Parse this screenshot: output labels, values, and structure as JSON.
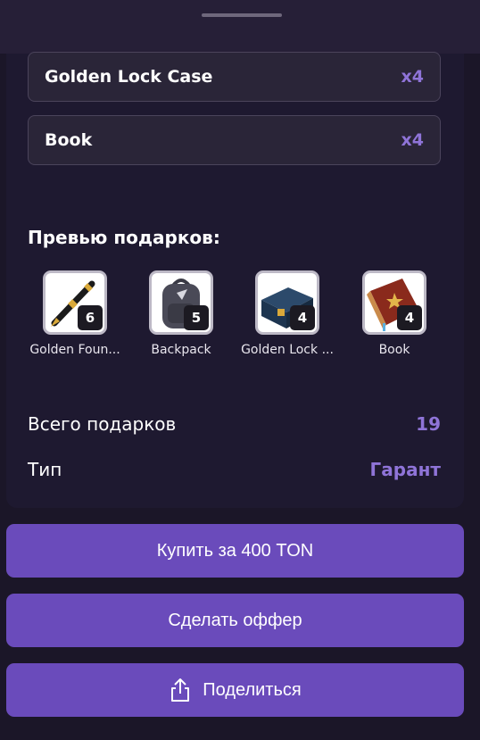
{
  "gifts": [
    {
      "name": "Golden Lock Case",
      "qty": "x4"
    },
    {
      "name": "Book",
      "qty": "x4"
    }
  ],
  "preview": {
    "title": "Превью подарков:",
    "items": [
      {
        "label": "Golden Foun...",
        "count": "6",
        "icon": "fountain-pen-icon"
      },
      {
        "label": "Backpack",
        "count": "5",
        "icon": "backpack-icon"
      },
      {
        "label": "Golden Lock ...",
        "count": "4",
        "icon": "lock-case-icon"
      },
      {
        "label": "Book",
        "count": "4",
        "icon": "book-icon"
      }
    ]
  },
  "stats": {
    "total_label": "Всего подарков",
    "total_value": "19",
    "type_label": "Тип",
    "type_value": "Гарант"
  },
  "actions": {
    "buy": "Купить за 400 TON",
    "offer": "Сделать оффер",
    "share": "Поделиться"
  },
  "colors": {
    "accent": "#8f74d8",
    "button": "#6a4bbb",
    "background": "#1b1628"
  }
}
